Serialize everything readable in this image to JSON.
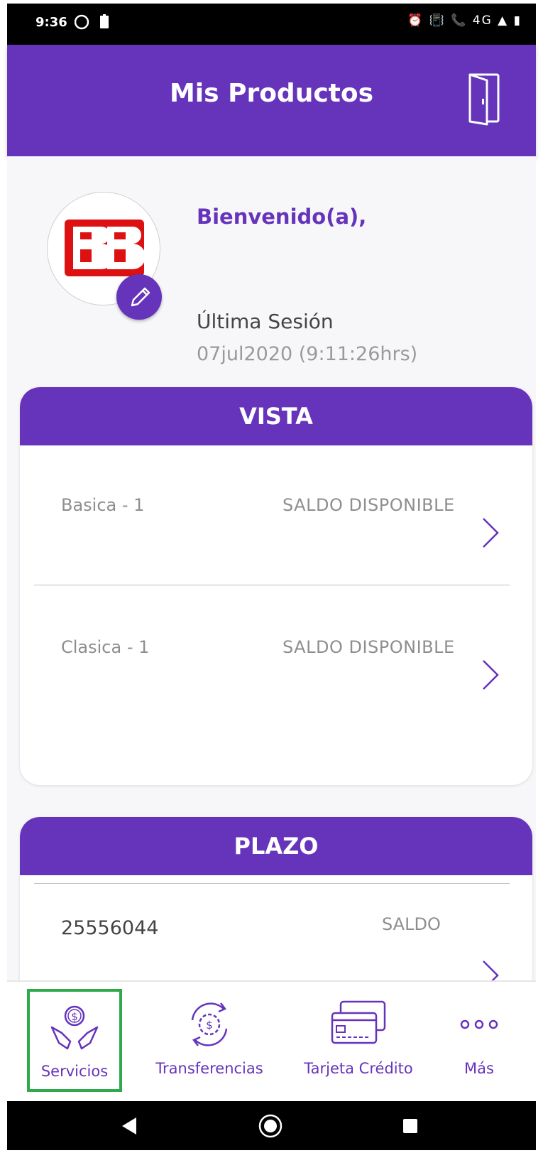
{
  "status_bar": {
    "time": "9:36",
    "right_icons": "⏰ 📳 📞 4G ▲ ▮"
  },
  "header": {
    "title": "Mis Productos"
  },
  "profile": {
    "welcome": "Bienvenido(a),",
    "last_session_label": "Última Sesión",
    "last_session_date": "07jul2020 (9:11:26hrs)"
  },
  "vista": {
    "title": "VISTA",
    "accounts": [
      {
        "name": "Basica - 1",
        "balance_label": "SALDO DISPONIBLE"
      },
      {
        "name": "Clasica - 1",
        "balance_label": "SALDO DISPONIBLE"
      }
    ]
  },
  "plazo": {
    "title": "PLAZO",
    "accounts": [
      {
        "number": "25556044",
        "balance_label": "SALDO"
      }
    ]
  },
  "bottom_nav": {
    "items": [
      {
        "label": "Servicios",
        "icon": "hands-coin-icon",
        "active": true
      },
      {
        "label": "Transferencias",
        "icon": "transfer-gear-icon",
        "active": false
      },
      {
        "label": "Tarjeta Crédito",
        "icon": "credit-card-icon",
        "active": false
      },
      {
        "label": "Más",
        "icon": "more-dots-icon",
        "active": false
      }
    ]
  },
  "colors": {
    "brand": "#6633bb",
    "active_outline": "#2eaa4a",
    "muted_text": "#8e8e8e"
  }
}
